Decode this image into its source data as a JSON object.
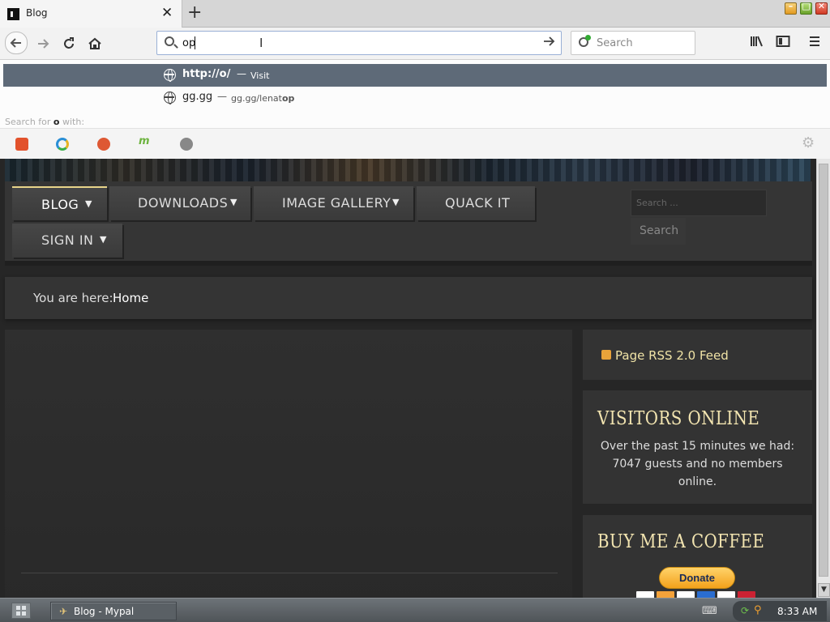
{
  "browser": {
    "tab": {
      "title": "Blog",
      "close": "✕"
    },
    "new_tab": "+",
    "window_buttons": {
      "minimize": "–",
      "maximize": "□",
      "close": "✕"
    },
    "url_value": "op",
    "search_placeholder": "Search",
    "icons": [
      "back-arrow-icon",
      "forward-arrow-icon",
      "reload-icon",
      "home-icon",
      "search-icon",
      "go-arrow-icon",
      "library-icon",
      "sidebar-icon",
      "hamburger-menu-icon"
    ]
  },
  "autocomplete": {
    "rows": [
      {
        "main": "http://o/",
        "sep": "—",
        "sub": "Visit"
      },
      {
        "main": "gg.gg",
        "sep": "—",
        "sub_prefix": "gg.gg/lenat",
        "sub_bold": "op"
      }
    ],
    "search_for_prefix": "Search for ",
    "search_for_term": "o",
    "search_for_suffix": " with:",
    "engine_colors": [
      "#e2522c",
      "#2a8fd6",
      "#de5833",
      "#6db33f",
      "#888888"
    ]
  },
  "site": {
    "menu": [
      {
        "label": "BLOG",
        "caret": "▼"
      },
      {
        "label": "DOWNLOADS",
        "caret": "▼"
      },
      {
        "label": "IMAGE GALLERY",
        "caret": "▼"
      },
      {
        "label": "QUACK IT"
      },
      {
        "label": "SIGN IN",
        "caret": "▼"
      }
    ],
    "search_placeholder": "Search ...",
    "search_button": "Search",
    "breadcrumb_label": "You are here:",
    "breadcrumb_home": "Home",
    "rss_text": "Page RSS 2.0 Feed",
    "visitors_title": "VISITORS ONLINE",
    "visitors_text": "Over the past 15 minutes we had: 7047 guests and no members online.",
    "coffee_title": "BUY ME A COFFEE",
    "donate_label": "Donate",
    "card_colors": [
      "#ffffff",
      "#f4a23a",
      "#ffffff",
      "#2a6dd0",
      "#ffffff",
      "#cc2233"
    ]
  },
  "taskbar": {
    "task_label": "Blog - Mypal",
    "clock": "8:33 AM"
  }
}
